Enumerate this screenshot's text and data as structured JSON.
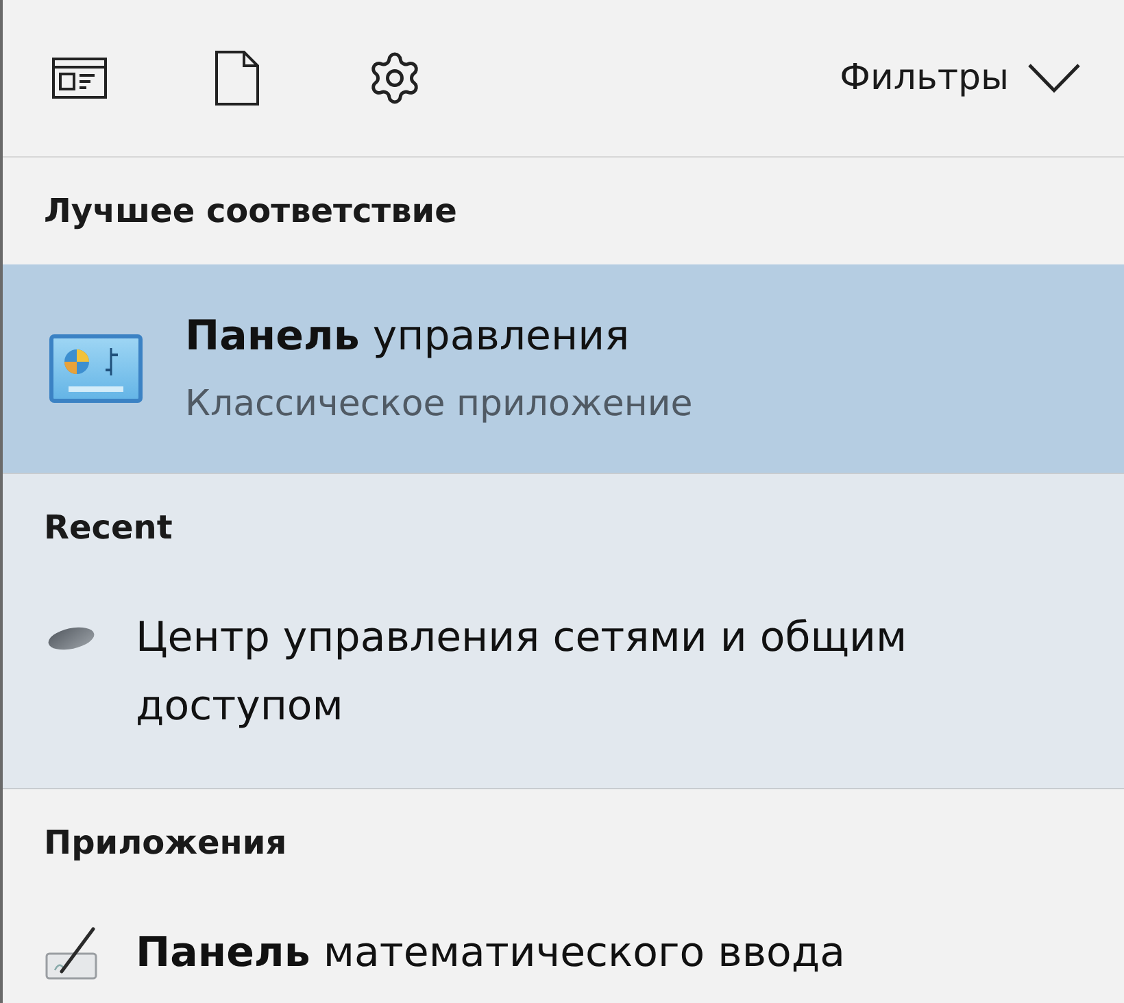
{
  "toolbar": {
    "filters_label": "Фильтры"
  },
  "sections": [
    {
      "heading": "Лучшее соответствие",
      "highlighted": false,
      "items": [
        {
          "kind": "best_match",
          "title": "**Панель** управления",
          "subtitle": "Классическое приложение",
          "selected": true
        }
      ]
    },
    {
      "heading": "Recent",
      "highlighted": true,
      "items": [
        {
          "kind": "result",
          "title": "Центр управления сетями и общим доступом",
          "selected": false
        }
      ]
    },
    {
      "heading": "Приложения",
      "highlighted": false,
      "items": [
        {
          "kind": "result",
          "title": "**Панель** математического ввода",
          "selected": false
        }
      ]
    }
  ]
}
